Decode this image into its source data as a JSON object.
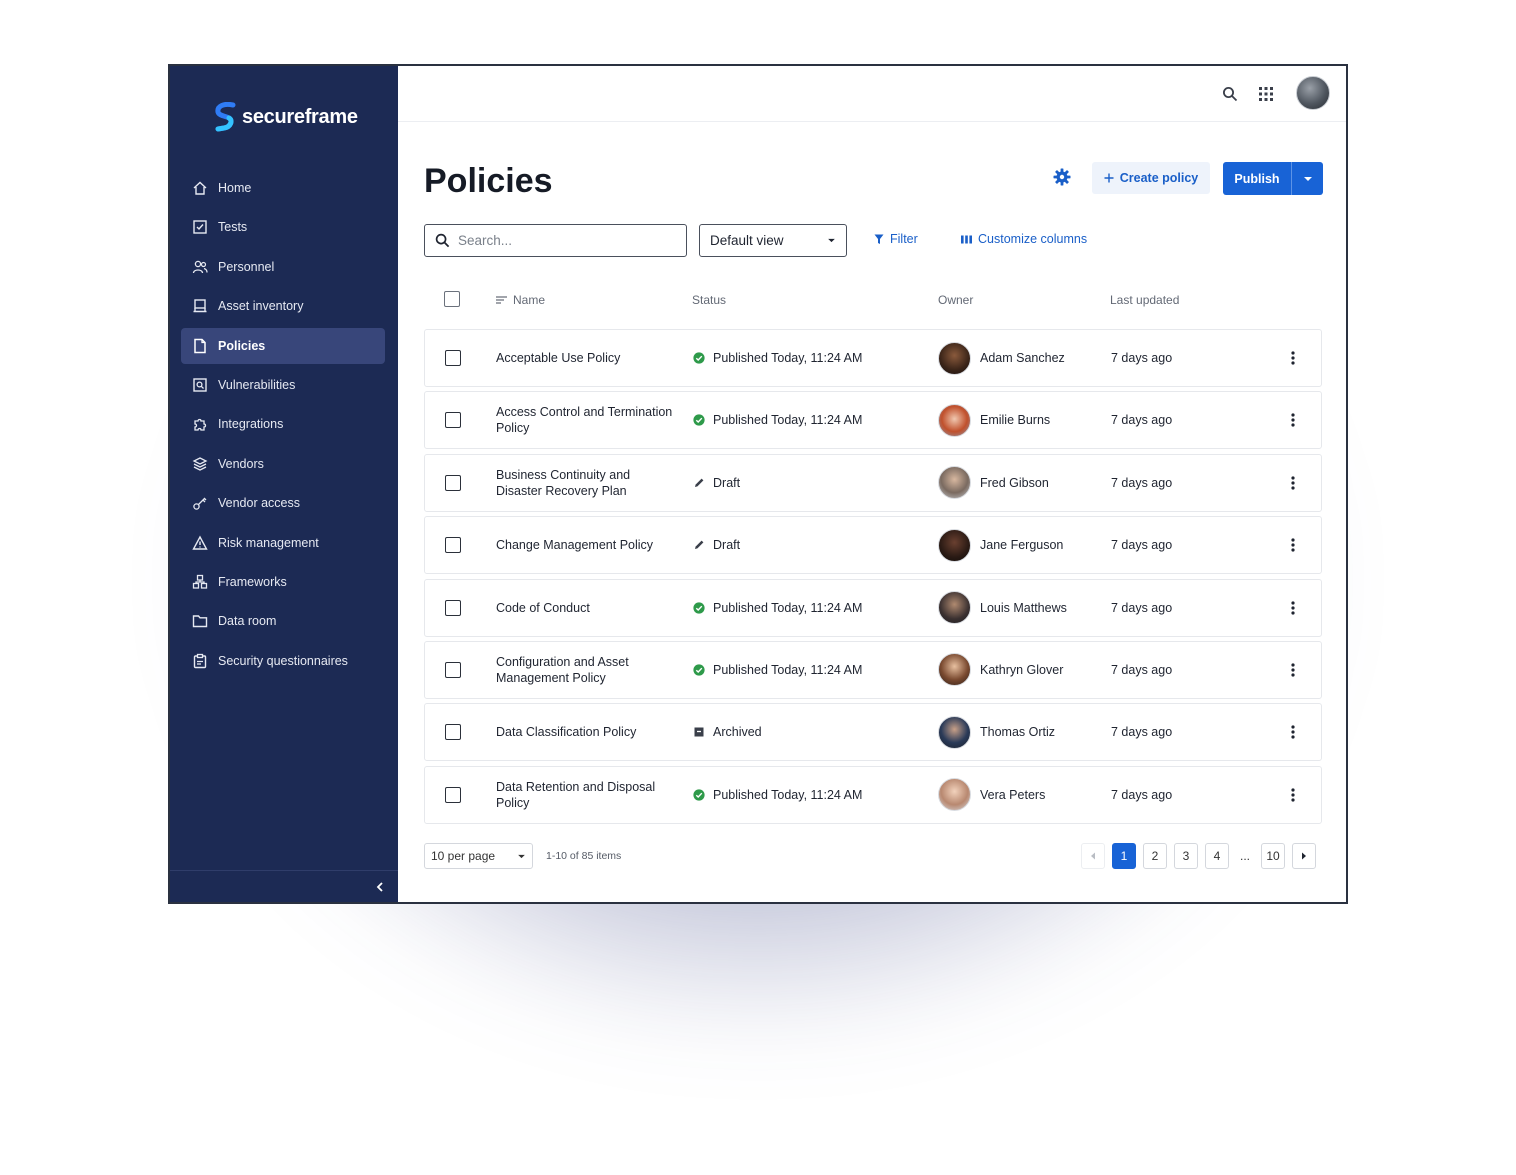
{
  "brand": {
    "name": "secureframe",
    "mark_color_top": "#2f7cf6",
    "mark_color_bottom": "#34c3ff"
  },
  "sidebar": {
    "items": [
      {
        "label": "Home",
        "icon": "home-icon",
        "active": false
      },
      {
        "label": "Tests",
        "icon": "checkbox-icon",
        "active": false
      },
      {
        "label": "Personnel",
        "icon": "people-icon",
        "active": false
      },
      {
        "label": "Asset inventory",
        "icon": "asset-icon",
        "active": false
      },
      {
        "label": "Policies",
        "icon": "document-icon",
        "active": true
      },
      {
        "label": "Vulnerabilities",
        "icon": "scan-icon",
        "active": false
      },
      {
        "label": "Integrations",
        "icon": "puzzle-icon",
        "active": false
      },
      {
        "label": "Vendors",
        "icon": "layers-icon",
        "active": false
      },
      {
        "label": "Vendor access",
        "icon": "key-icon",
        "active": false
      },
      {
        "label": "Risk management",
        "icon": "warning-icon",
        "active": false
      },
      {
        "label": "Frameworks",
        "icon": "framework-icon",
        "active": false
      },
      {
        "label": "Data room",
        "icon": "folder-icon",
        "active": false
      },
      {
        "label": "Security questionnaires",
        "icon": "clipboard-icon",
        "active": false
      }
    ]
  },
  "header": {
    "title": "Policies",
    "create_label": "Create policy",
    "publish_label": "Publish"
  },
  "toolbar": {
    "search_placeholder": "Search...",
    "view_label": "Default view",
    "filter_label": "Filter",
    "columns_label": "Customize columns"
  },
  "table": {
    "columns": {
      "name": "Name",
      "status": "Status",
      "owner": "Owner",
      "updated": "Last updated"
    },
    "rows": [
      {
        "name": "Acceptable Use Policy",
        "status": "Published Today, 11:24 AM",
        "status_type": "published",
        "owner": "Adam Sanchez",
        "updated": "7 days ago"
      },
      {
        "name": "Access Control and Termination Policy",
        "status": "Published Today, 11:24 AM",
        "status_type": "published",
        "owner": "Emilie Burns",
        "updated": "7 days ago"
      },
      {
        "name": "Business Continuity and Disaster Recovery Plan",
        "status": "Draft",
        "status_type": "draft",
        "owner": "Fred Gibson",
        "updated": "7 days ago"
      },
      {
        "name": "Change Management Policy",
        "status": "Draft",
        "status_type": "draft",
        "owner": "Jane Ferguson",
        "updated": "7 days ago"
      },
      {
        "name": "Code of Conduct",
        "status": "Published Today, 11:24 AM",
        "status_type": "published",
        "owner": "Louis Matthews",
        "updated": "7 days ago"
      },
      {
        "name": "Configuration and Asset Management Policy",
        "status": "Published Today, 11:24 AM",
        "status_type": "published",
        "owner": "Kathryn Glover",
        "updated": "7 days ago"
      },
      {
        "name": "Data Classification Policy",
        "status": "Archived",
        "status_type": "archived",
        "owner": "Thomas Ortiz",
        "updated": "7 days ago"
      },
      {
        "name": "Data Retention and Disposal Policy",
        "status": "Published Today, 11:24 AM",
        "status_type": "published",
        "owner": "Vera Peters",
        "updated": "7 days ago"
      }
    ]
  },
  "pagination": {
    "per_page_label": "10 per page",
    "count_label": "1-10 of 85 items",
    "pages": [
      "1",
      "2",
      "3",
      "4",
      "...",
      "10"
    ],
    "current": "1"
  },
  "colors": {
    "sidebar_bg": "#1c2a54",
    "sidebar_active": "#38467a",
    "primary": "#1863d6",
    "published_green": "#2e9a4a",
    "link_blue": "#1a5fc8"
  }
}
